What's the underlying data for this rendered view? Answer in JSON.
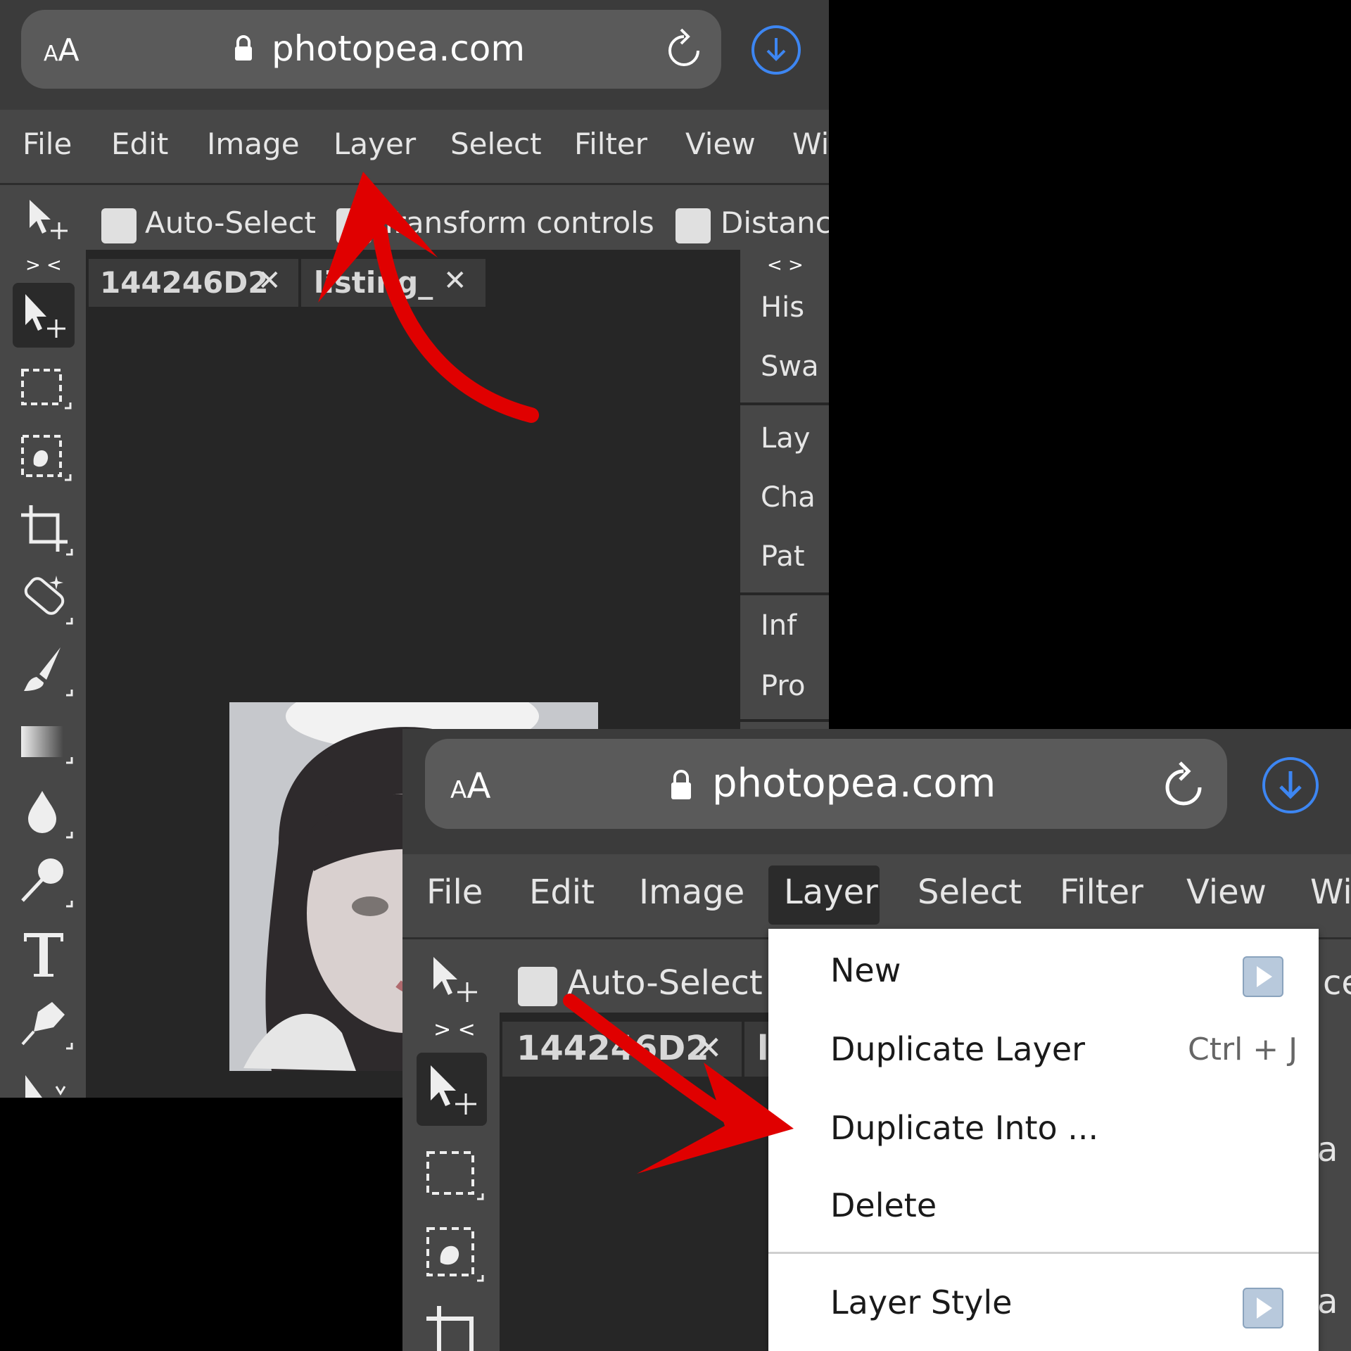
{
  "top": {
    "browser": {
      "aa": "AA",
      "domain": "photopea.com"
    },
    "menu": [
      "File",
      "Edit",
      "Image",
      "Layer",
      "Select",
      "Filter",
      "View",
      "Wi"
    ],
    "options": {
      "auto_select": "Auto-Select",
      "transform": "Transform controls",
      "distance": "Distance"
    },
    "collapse_left": "> <",
    "collapse_right": "< >",
    "tabs": [
      {
        "label": "144246D2",
        "close": "✕"
      },
      {
        "label": "listing_",
        "close": "✕"
      }
    ],
    "right_panel": [
      "His",
      "Swa",
      "Lay",
      "Cha",
      "Pat",
      "Inf",
      "Pro"
    ]
  },
  "bottom": {
    "browser": {
      "aa": "AA",
      "domain": "photopea.com"
    },
    "menu": [
      "File",
      "Edit",
      "Image",
      "Layer",
      "Select",
      "Filter",
      "View",
      "Wi"
    ],
    "options": {
      "auto_select": "Auto-Select",
      "clipped_right": "ce"
    },
    "collapse_left": "> <",
    "tabs": [
      {
        "label": "144246D2",
        "close": "✕"
      },
      {
        "label": "l",
        "close": ""
      }
    ],
    "right_edge": [
      "a",
      "a"
    ],
    "layer_menu": {
      "items": [
        {
          "label": "New",
          "shortcut": "",
          "submenu": true
        },
        {
          "label": "Duplicate Layer",
          "shortcut": "Ctrl + J",
          "submenu": false
        },
        {
          "label": "Duplicate Into ...",
          "shortcut": "",
          "submenu": false
        },
        {
          "label": "Delete",
          "shortcut": "",
          "submenu": false
        },
        {
          "label": "Layer Style",
          "shortcut": "",
          "submenu": true
        }
      ]
    }
  },
  "colors": {
    "accent_download": "#3d86f2",
    "annotation_arrow": "#e00000",
    "ui_dark": "#262626",
    "ui_panel": "#474747"
  }
}
